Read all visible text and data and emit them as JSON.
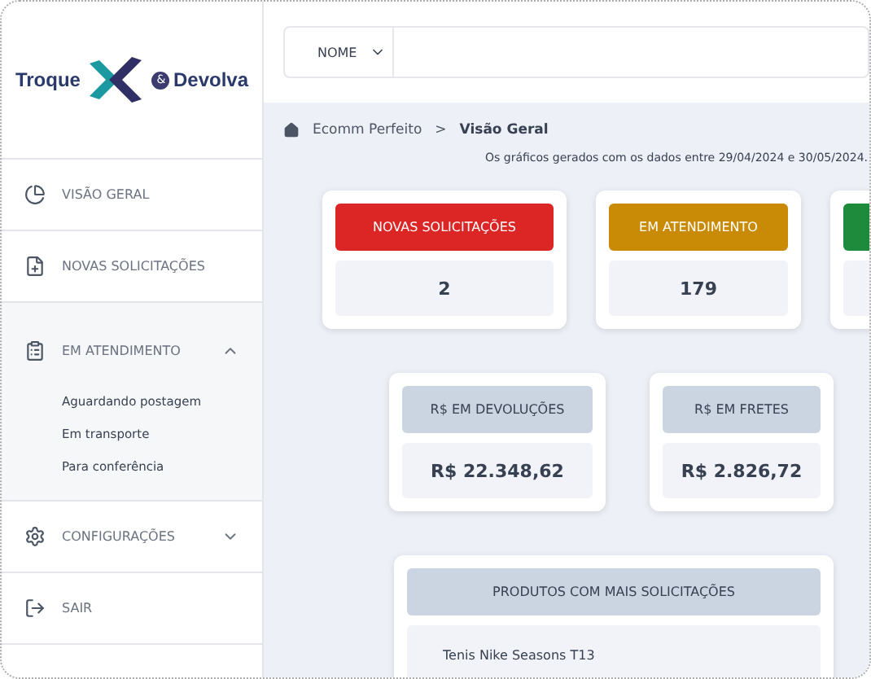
{
  "logo": {
    "left": "Troque",
    "middle": "&",
    "right": "Devolva"
  },
  "sidebar": {
    "items": [
      {
        "label": "VISÃO GERAL"
      },
      {
        "label": "NOVAS SOLICITAÇÕES"
      },
      {
        "label": "EM ATENDIMENTO",
        "expanded": true,
        "children": [
          {
            "label": "Aguardando postagem"
          },
          {
            "label": "Em transporte"
          },
          {
            "label": "Para conferência"
          }
        ]
      },
      {
        "label": "CONFIGURAÇÕES",
        "expanded": false
      },
      {
        "label": "SAIR"
      }
    ]
  },
  "search": {
    "filter": "NOME"
  },
  "breadcrumb": {
    "parent": "Ecomm Perfeito",
    "separator": ">",
    "current": "Visão Geral"
  },
  "date_note": "Os gráficos gerados com os dados entre 29/04/2024 e 30/05/2024.",
  "status_cards": [
    {
      "label": "NOVAS SOLICITAÇÕES",
      "value": "2",
      "color": "#dc2626"
    },
    {
      "label": "EM ATENDIMENTO",
      "value": "179",
      "color": "#c98a06"
    },
    {
      "color": "#1e8a3c"
    }
  ],
  "money_cards": [
    {
      "label": "R$ EM DEVOLUÇÕES",
      "value": "R$ 22.348,62"
    },
    {
      "label": "R$ EM FRETES",
      "value": "R$ 2.826,72"
    }
  ],
  "products": {
    "title": "PRODUTOS COM MAIS SOLICITAÇÕES",
    "items": [
      "Tenis Nike Seasons T13"
    ]
  }
}
